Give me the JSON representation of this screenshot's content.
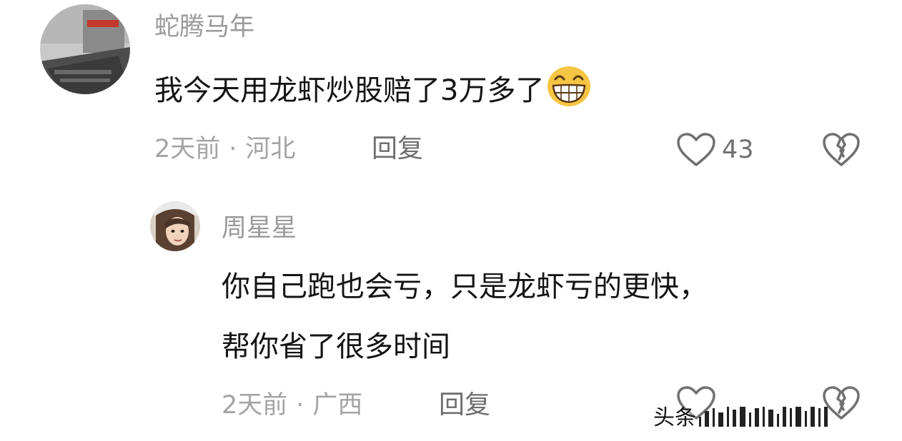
{
  "comments": [
    {
      "username": "蛇腾马年",
      "text": "我今天用龙虾炒股赔了3万多了",
      "emoji": "grinning-face-emoji",
      "time": "2天前",
      "separator": "·",
      "location": "河北",
      "reply_label": "回复",
      "likes": "43"
    }
  ],
  "reply": {
    "username": "周星星",
    "text_line1": "你自己跑也会亏，只是龙虾亏的更快，",
    "text_line2": "帮你省了很多时间",
    "time": "2天前",
    "separator": "·",
    "location": "广西",
    "reply_label": "回复"
  },
  "watermark": {
    "text": "头条"
  },
  "colors": {
    "username": "#9a9a9a",
    "meta": "#a4a4a4",
    "content": "#141414",
    "icon": "#707070",
    "emoji": "#f6c544"
  }
}
